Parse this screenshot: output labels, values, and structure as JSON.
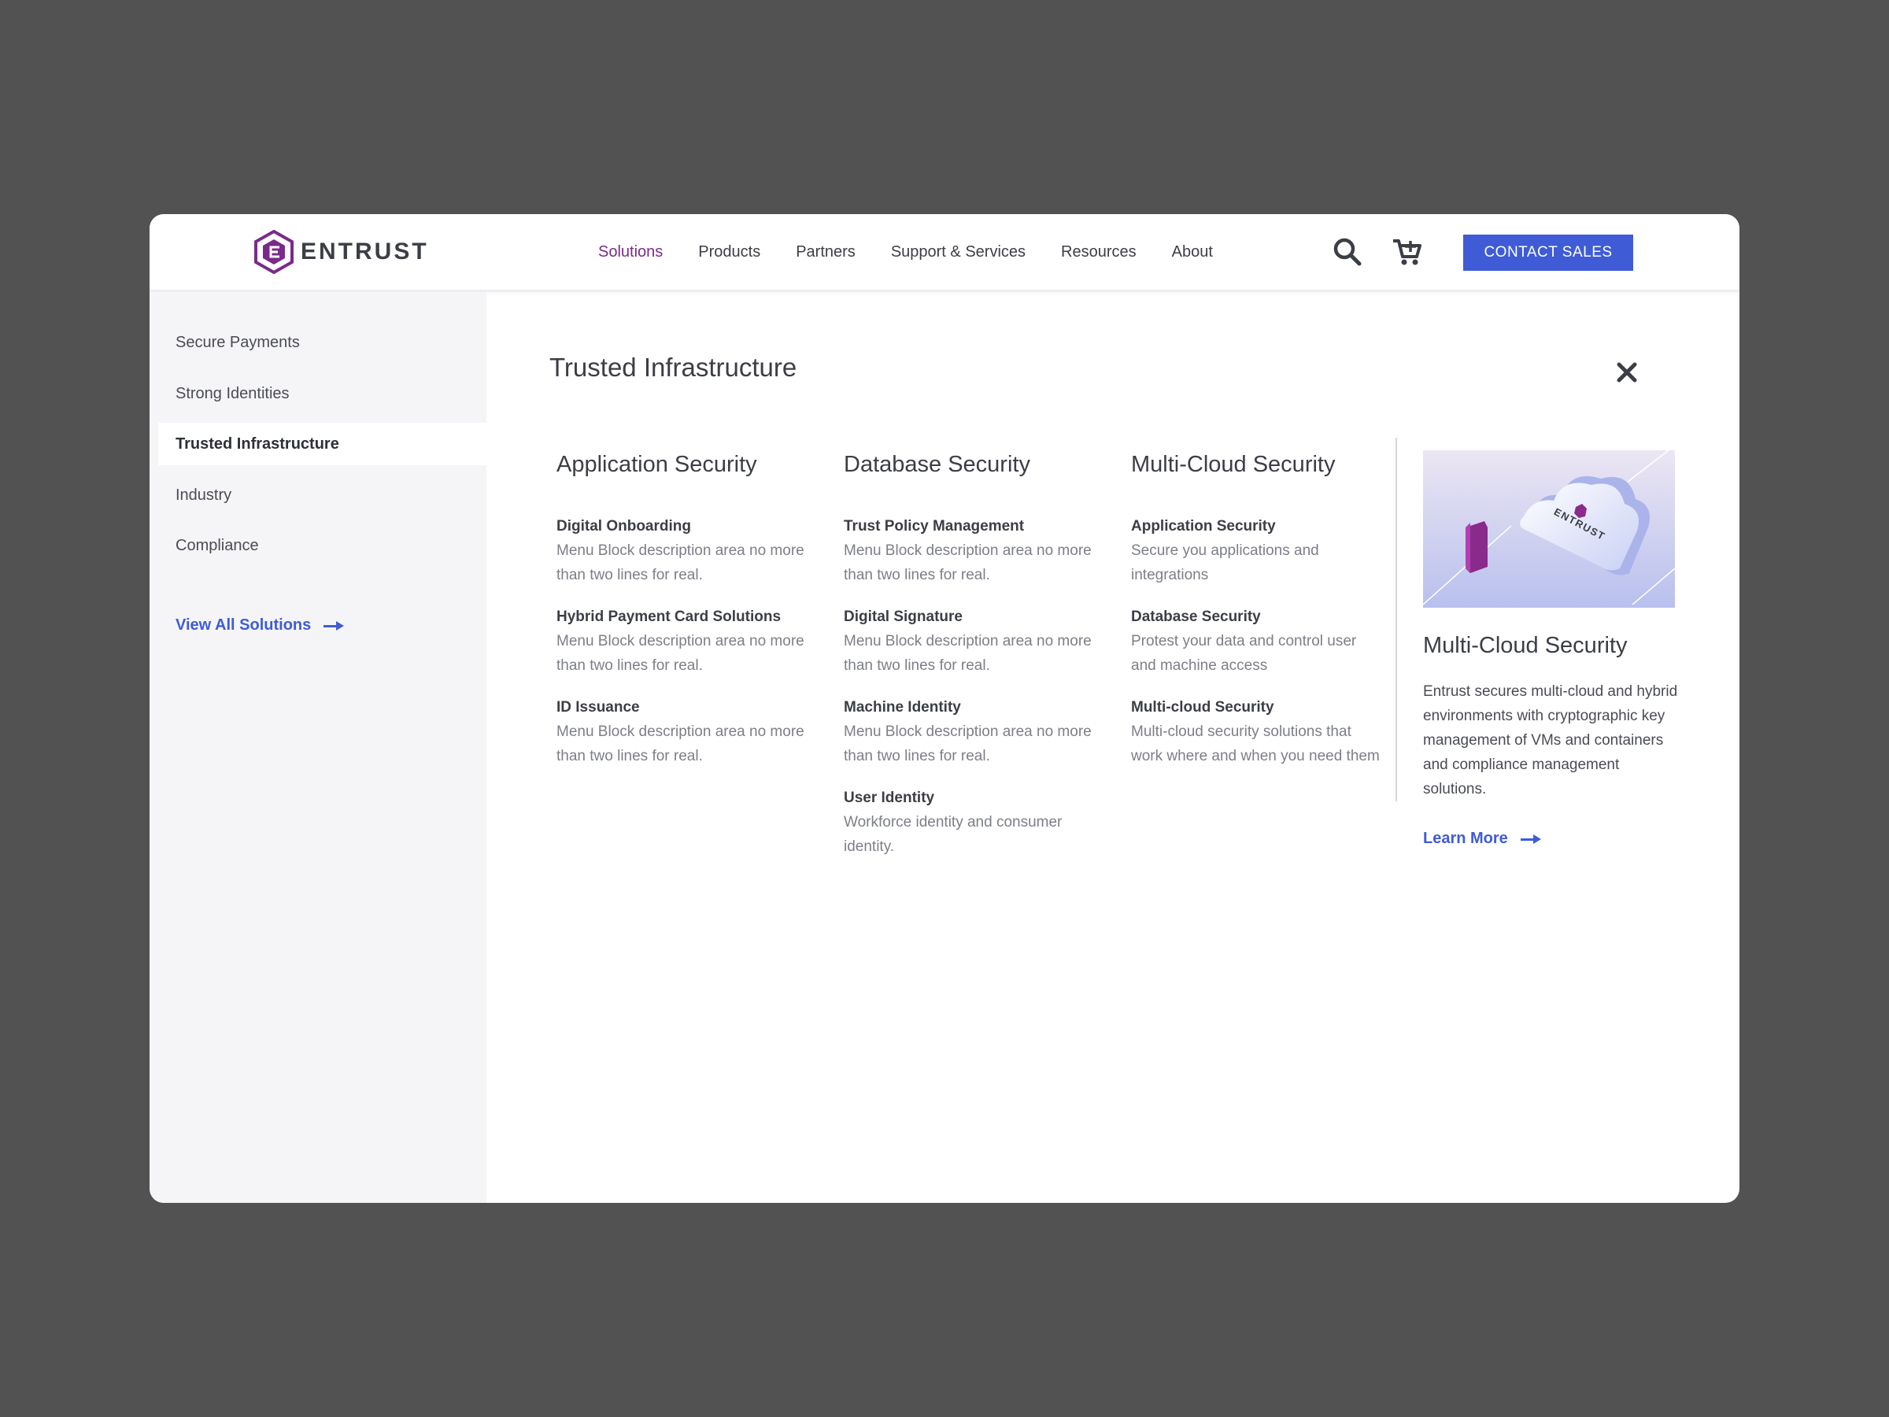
{
  "header": {
    "logo_text": "ENTRUST",
    "nav": [
      "Solutions",
      "Products",
      "Partners",
      "Support & Services",
      "Resources",
      "About"
    ],
    "active_nav": "Solutions",
    "contact_label": "CONTACT SALES",
    "icons": [
      "search-icon",
      "cart-icon"
    ]
  },
  "sidebar": {
    "items": [
      "Secure Payments",
      "Strong Identities",
      "Trusted Infrastructure",
      "Industry",
      "Compliance"
    ],
    "active_item": "Trusted Infrastructure",
    "view_all": "View All Solutions"
  },
  "main": {
    "title": "Trusted Infrastructure",
    "columns": [
      {
        "heading": "Application Security",
        "items": [
          {
            "title": "Digital Onboarding",
            "desc": "Menu Block description area no more than two lines for real."
          },
          {
            "title": "Hybrid Payment Card Solutions",
            "desc": "Menu Block description area no more than two lines for real."
          },
          {
            "title": "ID Issuance",
            "desc": "Menu Block description area no more than two lines for real."
          }
        ]
      },
      {
        "heading": "Database Security",
        "items": [
          {
            "title": "Trust Policy Management",
            "desc": "Menu Block description area no more than two lines for real."
          },
          {
            "title": "Digital Signature",
            "desc": "Menu Block description area no more than two lines for real."
          },
          {
            "title": "Machine Identity",
            "desc": "Menu Block description area no more than two lines for real."
          },
          {
            "title": "User Identity",
            "desc": "Workforce identity and consumer identity."
          }
        ]
      },
      {
        "heading": "Multi-Cloud Security",
        "items": [
          {
            "title": "Application Security",
            "desc": "Secure you applications and integrations"
          },
          {
            "title": "Database Security",
            "desc": "Protest your data and control user and machine access"
          },
          {
            "title": "Multi-cloud Security",
            "desc": "Multi-cloud security solutions that work where and when you need them"
          }
        ]
      }
    ],
    "feature": {
      "image_text": "ENTRUST",
      "title": "Multi-Cloud Security",
      "text": "Entrust secures multi-cloud and hybrid environments with cryptographic key management of VMs and containers and compliance management solutions.",
      "link": "Learn More"
    }
  },
  "colors": {
    "brand_purple": "#7a2b8a",
    "accent_blue": "#3f5cd6",
    "backdrop": "#525252",
    "sidebar_bg": "#f5f5f7"
  }
}
